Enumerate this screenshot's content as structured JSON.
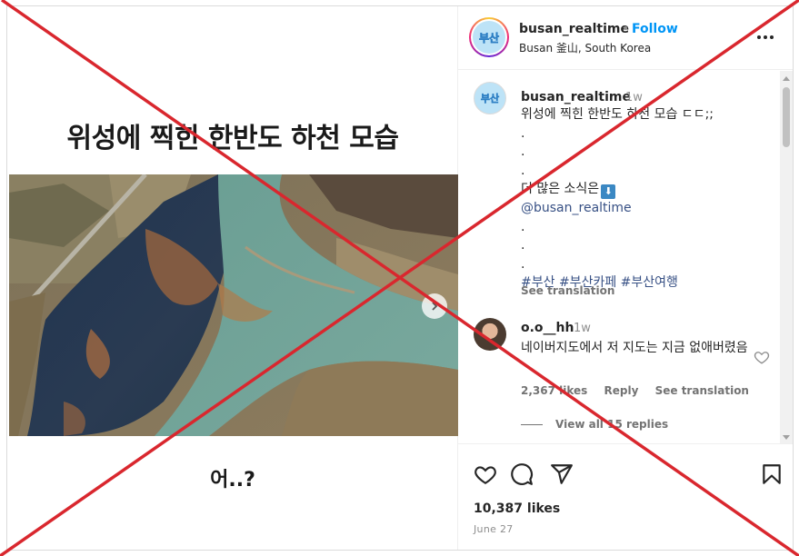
{
  "post": {
    "title_text": "위성에 찍힌 한반도 하천 모습",
    "caption_text": "어..?"
  },
  "header": {
    "username": "busan_realtime",
    "separator": "•",
    "follow_label": "Follow",
    "location": "Busan 釜山, South Korea",
    "avatar_text": "부산"
  },
  "caption": {
    "username": "busan_realtime",
    "time": "1w",
    "avatar_text": "부산",
    "lines": [
      "위성에 찍힌 한반도 하천 모습 ㄷㄷ;;",
      ".",
      ".",
      ".",
      "더 많은 소식은",
      "@busan_realtime",
      ".",
      ".",
      "."
    ],
    "emoji": "⬇",
    "hashtags": [
      "#부산",
      "#부산카페",
      "#부산여행"
    ],
    "see_translation": "See translation"
  },
  "comment": {
    "username": "o.o__hh",
    "time": "1w",
    "text": "네이버지도에서 저 지도는 지금 없애버렸음",
    "likes": "2,367 likes",
    "reply": "Reply",
    "see_translation": "See translation",
    "view_replies": "View all 15 replies"
  },
  "actions": {
    "likes": "10,387 likes",
    "date": "June 27"
  },
  "colors": {
    "link_blue": "#0095f6",
    "hashtag": "#385185",
    "overlay_red": "#d9272e"
  },
  "icons": [
    "more-icon",
    "heart-icon",
    "comment-icon",
    "share-icon",
    "bookmark-icon",
    "chevron-right-icon"
  ]
}
